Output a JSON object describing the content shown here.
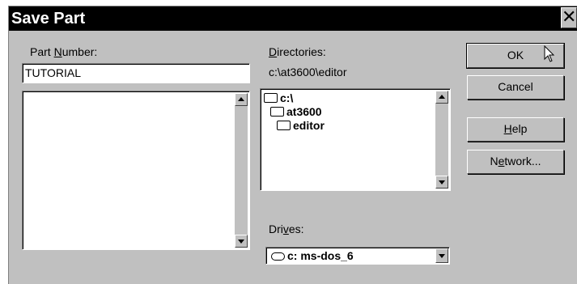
{
  "window": {
    "title": "Save Part"
  },
  "part_number": {
    "label": "Part Number:",
    "label_pre": "Part ",
    "label_accel": "N",
    "label_post": "umber:",
    "value": "TUTORIAL"
  },
  "directories": {
    "label_accel": "D",
    "label_post": "irectories:",
    "current_path": "c:\\at3600\\editor",
    "items": [
      "c:\\",
      "at3600",
      "editor"
    ]
  },
  "drives": {
    "label_pre": "Dri",
    "label_accel": "v",
    "label_post": "es:",
    "selected": "c: ms-dos_6"
  },
  "buttons": {
    "ok": "OK",
    "cancel": "Cancel",
    "help_accel": "H",
    "help_post": "elp",
    "network_pre": "N",
    "network_accel": "e",
    "network_post": "twork..."
  }
}
